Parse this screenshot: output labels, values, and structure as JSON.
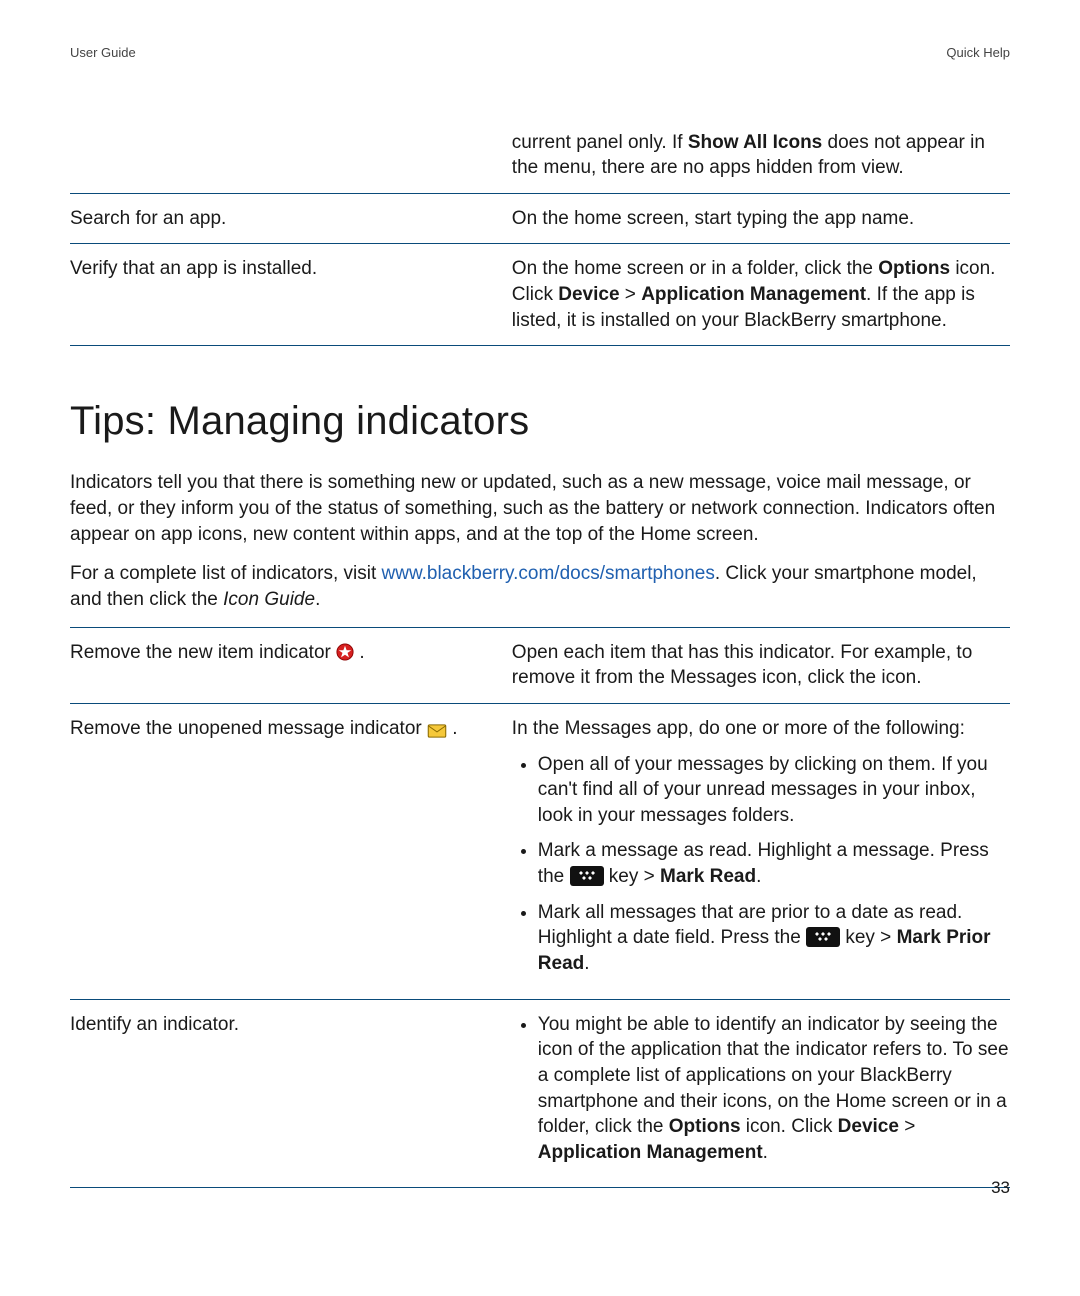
{
  "header": {
    "left": "User Guide",
    "right": "Quick Help"
  },
  "table1": {
    "rows": [
      {
        "left": "",
        "right_before": "current panel only. If ",
        "right_bold1": "Show All Icons",
        "right_after": " does not appear in the menu, there are no apps hidden from view."
      },
      {
        "left": "Search for an app.",
        "right_plain": "On the home screen, start typing the app name."
      },
      {
        "left": "Verify that an app is installed.",
        "right_a": "On the home screen or in a folder, click the ",
        "right_b_bold": "Options",
        "right_c": " icon. Click ",
        "right_d_bold": "Device",
        "right_e": " > ",
        "right_f_bold": "Application Management",
        "right_g": ". If the app is listed, it is installed on your BlackBerry smartphone."
      }
    ]
  },
  "section": {
    "title": "Tips: Managing indicators",
    "para1": "Indicators tell you that there is something new or updated, such as a new message, voice mail message, or feed, or they inform you of the status of something, such as the battery or network connection. Indicators often appear on app icons, new content within apps, and at the top of the Home screen.",
    "para2_a": "For a complete list of indicators, visit ",
    "para2_link": "www.blackberry.com/docs/smartphones",
    "para2_b": ". Click your smartphone model, and then click the ",
    "para2_italic": "Icon Guide",
    "para2_c": "."
  },
  "table2": {
    "row1": {
      "left_a": "Remove the new item indicator ",
      "left_b": " .",
      "right": "Open each item that has this indicator. For example, to remove it from the Messages icon, click the icon."
    },
    "row2": {
      "left_a": "Remove the unopened message indicator ",
      "left_b": " .",
      "right_intro": "In the Messages app, do one or more of the following:",
      "b1": "Open all of your messages by clicking on them. If you can't find all of your unread messages in your inbox, look in your messages folders.",
      "b2_a": "Mark a message as read. Highlight a message. Press the ",
      "b2_b": " key > ",
      "b2_bold": "Mark Read",
      "b2_c": ".",
      "b3_a": "Mark all messages that are prior to a date as read. Highlight a date field. Press the ",
      "b3_b": " key > ",
      "b3_bold": "Mark Prior Read",
      "b3_c": "."
    },
    "row3": {
      "left": "Identify an indicator.",
      "b1_a": "You might be able to identify an indicator by seeing the icon of the application that the indicator refers to. To see a complete list of applications on your BlackBerry smartphone and their icons, on the Home screen or in a folder, click the ",
      "b1_bold1": "Options",
      "b1_b": " icon. Click ",
      "b1_bold2": "Device",
      "b1_c": " > ",
      "b1_bold3": "Application Management",
      "b1_d": "."
    }
  },
  "page_number": "33"
}
